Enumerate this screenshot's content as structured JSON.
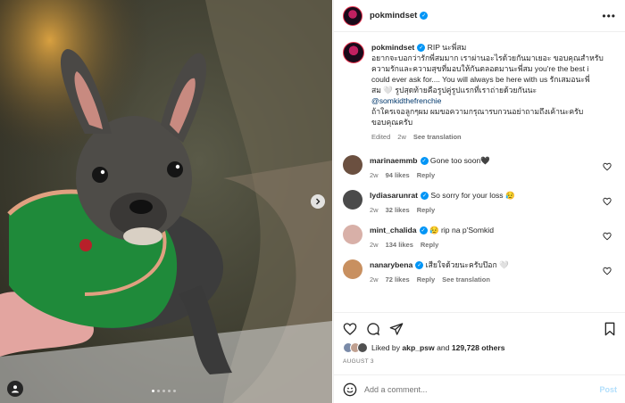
{
  "post": {
    "author": "pokmindset",
    "caption_lines": [
      "RIP นะพี่สม",
      "อยากจะบอกว่ารักพี่สมมาก เราผ่านอะไรด้วยกันมาเยอะ ขอบคุณสำหรับ",
      "ความรักและความสุขที่มอบให้กันตลอดมานะพี่สม you're the best i",
      "could ever ask for.... You will always be here with us รักเสมอนะพี่",
      "สม 🤍 รูปสุดท้ายคือรูปคู่รูปแรกที่เราถ่ายด้วยกันนะ",
      "@somkidthefrenchie",
      "ถ้าใครเจอลูกๆผม ผมขอความกรุณารบกวนอย่าถามถึงเค้านะครับ",
      "ขอบคุณครับ"
    ],
    "caption_meta": {
      "edited": "Edited",
      "age": "2w",
      "see_translation": "See translation"
    },
    "likes": {
      "liked_by": "Liked by",
      "user": "akp_psw",
      "and": "and",
      "others": "129,728 others"
    },
    "date": "AUGUST 3",
    "comment_placeholder": "Add a comment...",
    "post_label": "Post"
  },
  "comments": [
    {
      "user": "marinaemmb",
      "text": "Gone too soon🖤",
      "age": "2w",
      "likes": "94 likes",
      "reply": "Reply",
      "translate": "",
      "color": "#6b5040"
    },
    {
      "user": "lydiasarunrat",
      "text": "So sorry for your loss 😥",
      "age": "2w",
      "likes": "32 likes",
      "reply": "Reply",
      "translate": "",
      "color": "#4a4a4a"
    },
    {
      "user": "mint_chalida",
      "text": "😥 rip na p'Somkid",
      "age": "2w",
      "likes": "134 likes",
      "reply": "Reply",
      "translate": "",
      "color": "#d8b0a8"
    },
    {
      "user": "nanarybena",
      "text": "เสียใจด้วยนะครับป๊อก 🤍",
      "age": "2w",
      "likes": "72 likes",
      "reply": "Reply",
      "translate": "See translation",
      "color": "#c89060"
    }
  ],
  "icons": {
    "more": "more-options-icon",
    "next": "chevron-right-icon",
    "tag": "user-tag-icon",
    "like": "heart-icon",
    "comment": "comment-icon",
    "share": "share-icon",
    "save": "bookmark-icon",
    "emoji": "emoji-icon"
  },
  "colors": {
    "verified": "#0095f6",
    "link": "#00376b",
    "muted": "#737373",
    "post_disabled": "#b2dffc"
  }
}
